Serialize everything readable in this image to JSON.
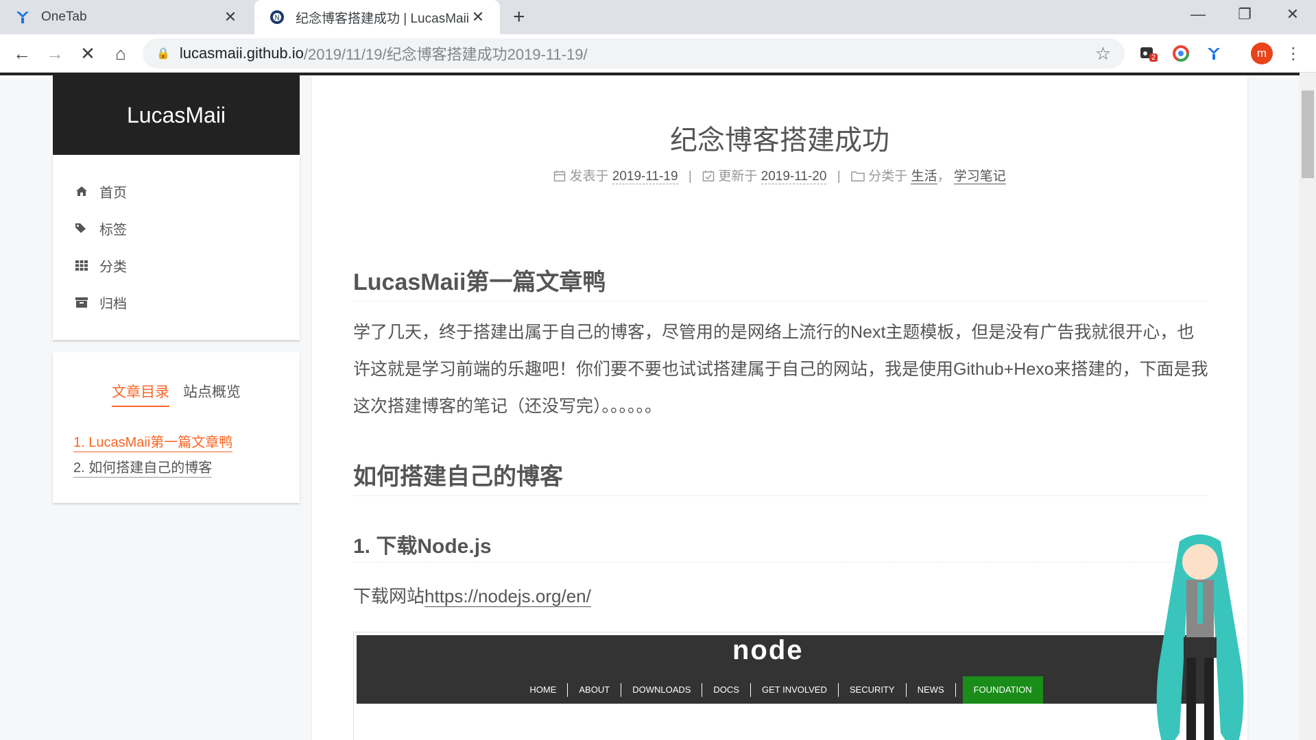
{
  "browser": {
    "tabs": [
      {
        "title": "OneTab",
        "icon": "onetab-icon",
        "active": false
      },
      {
        "title": "纪念博客搭建成功 | LucasMaii",
        "icon": "site-favicon",
        "active": true
      }
    ],
    "url_host": "lucasmaii.github.io",
    "url_path": "/2019/11/19/纪念博客搭建成功2019-11-19/",
    "badge_count": "2",
    "profile_initial": "m"
  },
  "site": {
    "brand": "LucasMaii",
    "menu": [
      {
        "label": "首页",
        "icon": "home-icon"
      },
      {
        "label": "标签",
        "icon": "tags-icon"
      },
      {
        "label": "分类",
        "icon": "grid-icon"
      },
      {
        "label": "归档",
        "icon": "archive-icon"
      }
    ],
    "toc_tabs": [
      "文章目录",
      "站点概览"
    ],
    "toc": [
      "1. LucasMaii第一篇文章鸭",
      "2. 如何搭建自己的博客"
    ]
  },
  "post": {
    "title": "纪念博客搭建成功",
    "meta": {
      "posted_label": "发表于",
      "posted_date": "2019-11-19",
      "updated_label": "更新于",
      "updated_date": "2019-11-20",
      "category_label": "分类于",
      "categories": [
        "生活",
        "学习笔记"
      ]
    },
    "h1": "LucasMaii第一篇文章鸭",
    "paragraph": "学了几天，终于搭建出属于自己的博客，尽管用的是网络上流行的Next主题模板，但是没有广告我就很开心，也许这就是学习前端的乐趣吧！你们要不要也试试搭建属于自己的网站，我是使用Github+Hexo来搭建的，下面是我这次搭建博客的笔记（还没写完）。。。。。。",
    "h2": "如何搭建自己的博客",
    "h3": "1. 下载Node.js",
    "download_label": "下载网站",
    "download_link": "https://nodejs.org/en/",
    "node_screenshot": {
      "logo": "node",
      "nav": [
        "HOME",
        "ABOUT",
        "DOWNLOADS",
        "DOCS",
        "GET INVOLVED",
        "SECURITY",
        "NEWS"
      ],
      "highlight": "FOUNDATION"
    }
  },
  "colors": {
    "accent": "#fc6423",
    "header": "#222222",
    "node_green": "#1a8c1a"
  }
}
